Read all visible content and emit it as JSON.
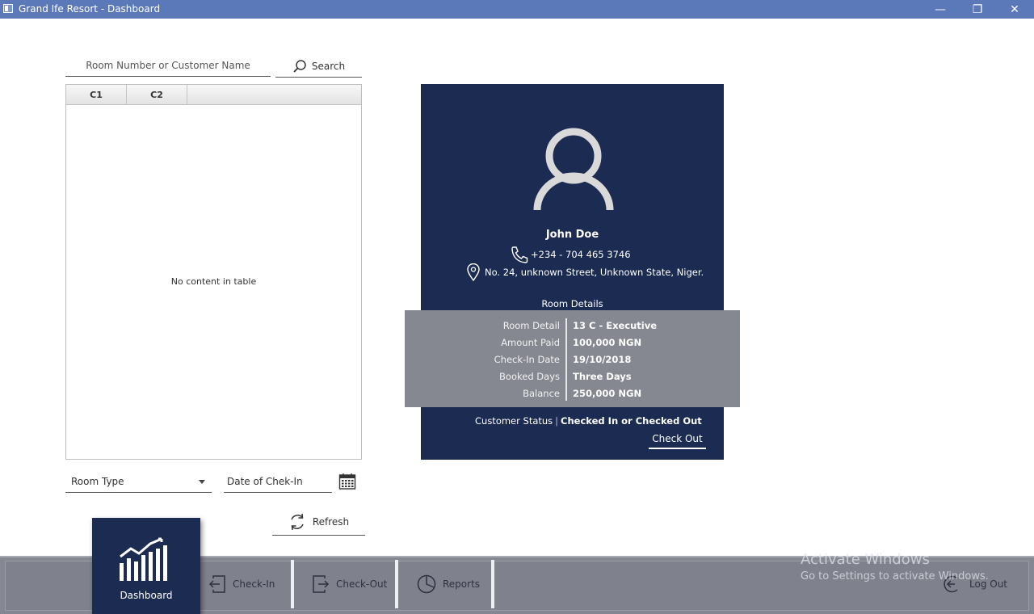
{
  "window": {
    "title": "Grand Ife Resort - Dashboard",
    "minimize": "—",
    "restore": "❐",
    "close": "✕"
  },
  "search": {
    "placeholder": "Room Number or Customer Name",
    "button_label": "Search"
  },
  "table": {
    "columns": [
      "C1",
      "C2"
    ],
    "empty_message": "No content in table"
  },
  "filters": {
    "room_type_label": "Room Type",
    "date_placeholder": "Date of Chek-In",
    "refresh_label": "Refresh"
  },
  "customer": {
    "name": "John Doe",
    "phone": "+234 - 704 465 3746",
    "address": "No. 24, unknown Street, Unknown State, Niger."
  },
  "room_details": {
    "heading": "Room Details",
    "rows": [
      {
        "label": "Room Detail",
        "value": "13 C - Executive"
      },
      {
        "label": "Amount Paid",
        "value": "100,000 NGN"
      },
      {
        "label": "Check-In Date",
        "value": "19/10/2018"
      },
      {
        "label": "Booked Days",
        "value": "Three Days"
      },
      {
        "label": "Balance",
        "value": "250,000 NGN"
      }
    ]
  },
  "status": {
    "label": "Customer Status",
    "divider": "|",
    "value": "Checked In or Checked Out",
    "checkout_label": "Check Out"
  },
  "nav": {
    "dashboard": "Dashboard",
    "check_in": "Check-In",
    "check_out": "Check-Out",
    "reports": "Reports",
    "logout": "Log Out"
  },
  "watermark": {
    "line1": "Activate Windows",
    "line2": "Go to Settings to activate Windows."
  },
  "colors": {
    "titlebar": "#5b78b8",
    "card": "#1c2b52",
    "details_panel": "#868891",
    "navbar": "#858892"
  },
  "icons": [
    "app-icon",
    "search-icon",
    "calendar-icon",
    "refresh-icon",
    "user-avatar-icon",
    "phone-icon",
    "location-pin-icon",
    "chart-icon",
    "check-in-icon",
    "check-out-icon",
    "reports-icon",
    "logout-icon"
  ]
}
